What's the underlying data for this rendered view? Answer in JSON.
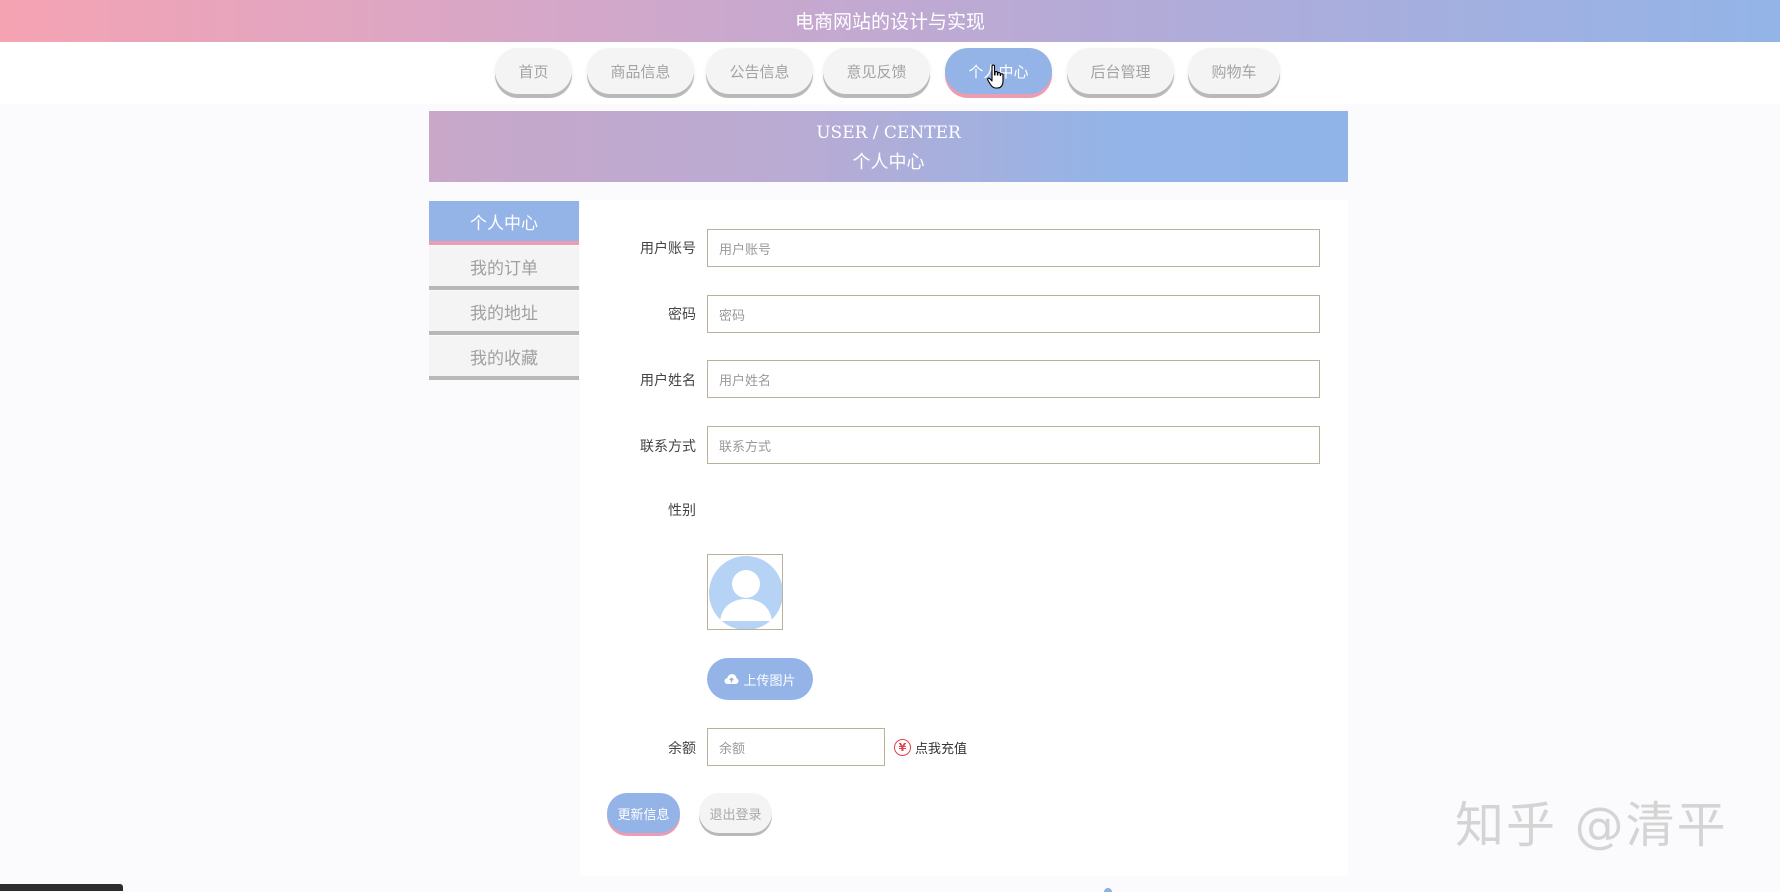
{
  "site": {
    "title": "电商网站的设计与实现"
  },
  "nav": {
    "items": [
      {
        "label": "首页"
      },
      {
        "label": "商品信息"
      },
      {
        "label": "公告信息"
      },
      {
        "label": "意见反馈"
      },
      {
        "label": "个人中心",
        "active": true
      },
      {
        "label": "后台管理"
      },
      {
        "label": "购物车"
      }
    ]
  },
  "banner": {
    "en": "USER / CENTER",
    "cn": "个人中心"
  },
  "sidebar": {
    "items": [
      {
        "label": "个人中心",
        "active": true
      },
      {
        "label": "我的订单"
      },
      {
        "label": "我的地址"
      },
      {
        "label": "我的收藏"
      }
    ]
  },
  "form": {
    "account": {
      "label": "用户账号",
      "placeholder": "用户账号"
    },
    "password": {
      "label": "密码",
      "placeholder": "密码"
    },
    "name": {
      "label": "用户姓名",
      "placeholder": "用户姓名"
    },
    "contact": {
      "label": "联系方式",
      "placeholder": "联系方式"
    },
    "gender": {
      "label": "性别"
    },
    "upload_label": "上传图片",
    "balance": {
      "label": "余额",
      "placeholder": "余额"
    },
    "recharge_label": "点我充值",
    "recharge_icon": "¥",
    "update_label": "更新信息",
    "logout_label": "退出登录"
  },
  "watermark": "知乎 @清平",
  "colors": {
    "accent": "#94b3e6",
    "pink": "#ec9db4",
    "danger": "#e0424f"
  }
}
